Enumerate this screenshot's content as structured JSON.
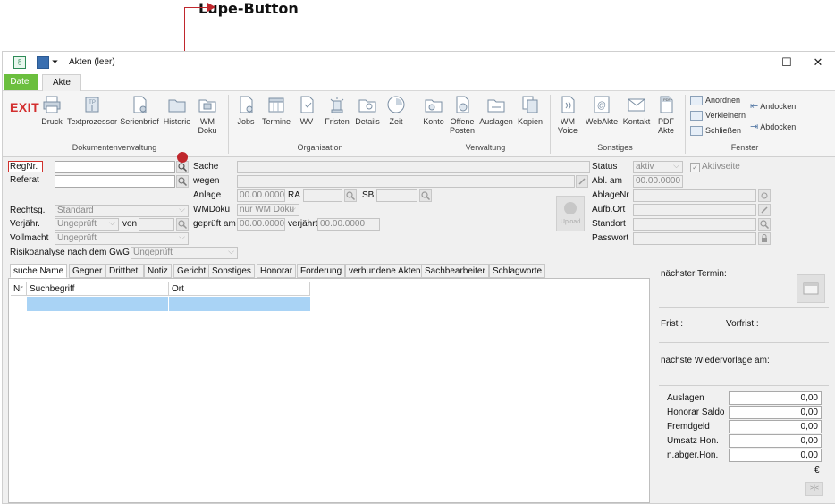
{
  "annotation": {
    "label": "Lupe-Button",
    "color": "#c0272d"
  },
  "window": {
    "title": "Akten (leer)",
    "minimize": "—",
    "maximize": "☐",
    "close": "✕"
  },
  "menu_tabs": {
    "datei": "Datei",
    "akte": "Akte"
  },
  "ribbon": {
    "exit": "EXIT",
    "dokumentenverwaltung": {
      "group": "Dokumentenverwaltung",
      "items": [
        "Druck",
        "Textprozessor",
        "Serienbrief",
        "Historie",
        "WM\nDoku"
      ]
    },
    "organisation": {
      "group": "Organisation",
      "items": [
        "Jobs",
        "Termine",
        "WV",
        "Fristen",
        "Details",
        "Zeit"
      ]
    },
    "verwaltung": {
      "group": "Verwaltung",
      "items": [
        "Konto",
        "Offene\nPosten",
        "Auslagen",
        "Kopien"
      ]
    },
    "sonstiges": {
      "group": "Sonstiges",
      "items": [
        "WM\nVoice",
        "WebAkte",
        "Kontakt",
        "PDF\nAkte"
      ]
    },
    "fenster": {
      "group": "Fenster",
      "items": [
        "Anordnen",
        "Verkleinern",
        "Schließen",
        "Andocken",
        "Abdocken"
      ]
    }
  },
  "form": {
    "regnr": "RegNr.",
    "referat": "Referat",
    "rechtsg": "Rechtsg.",
    "rechtsg_value": "Standard",
    "verjaehr": "Verjähr.",
    "verjaehr_value": "Ungeprüft",
    "von": "von",
    "vollmacht": "Vollmacht",
    "vollmacht_value": "Ungeprüft",
    "risiko": "Risikoanalyse nach dem GwG",
    "risiko_value": "Ungeprüft",
    "sache": "Sache",
    "wegen": "wegen",
    "anlage": "Anlage",
    "anlage_value": "00.00.0000",
    "ra": "RA",
    "sb": "SB",
    "wmdoku": "WMDoku",
    "wmdoku_value": "nur WM Doku",
    "geprueft_am": "geprüft am",
    "geprueft_value": "00.00.0000",
    "verjaehrt": "verjährt",
    "verjaehrt_value": "00.00.0000",
    "upload": "Upload",
    "status": "Status",
    "status_value": "aktiv",
    "aktivseite": "Aktivseite",
    "abl_am": "Abl. am",
    "abl_value": "00.00.0000",
    "ablagenr": "AblageNr",
    "aufb_ort": "Aufb.Ort",
    "standort": "Standort",
    "passwort": "Passwort"
  },
  "lower_tabs": [
    "suche Name",
    "Gegner",
    "Drittbet.",
    "Notiz",
    "Gericht",
    "Sonstiges",
    "Honorar",
    "Forderung",
    "verbundene Akten",
    "Sachbearbeiter",
    "Schlagworte"
  ],
  "grid": {
    "columns": [
      "Nr",
      "Suchbegriff",
      "Ort"
    ]
  },
  "right_panel": {
    "naechster_termin": "nächster Termin:",
    "frist": "Frist :",
    "vorfrist": "Vorfrist :",
    "wiedervorlage": "nächste Wiedervorlage am:",
    "summary": [
      {
        "label": "Auslagen",
        "value": "0,00"
      },
      {
        "label": "Honorar Saldo",
        "value": "0,00"
      },
      {
        "label": "Fremdgeld",
        "value": "0,00"
      },
      {
        "label": "Umsatz Hon.",
        "value": "0,00"
      },
      {
        "label": "n.abger.Hon.",
        "value": "0,00"
      }
    ],
    "currency": "€",
    "collapse": ">|<"
  }
}
